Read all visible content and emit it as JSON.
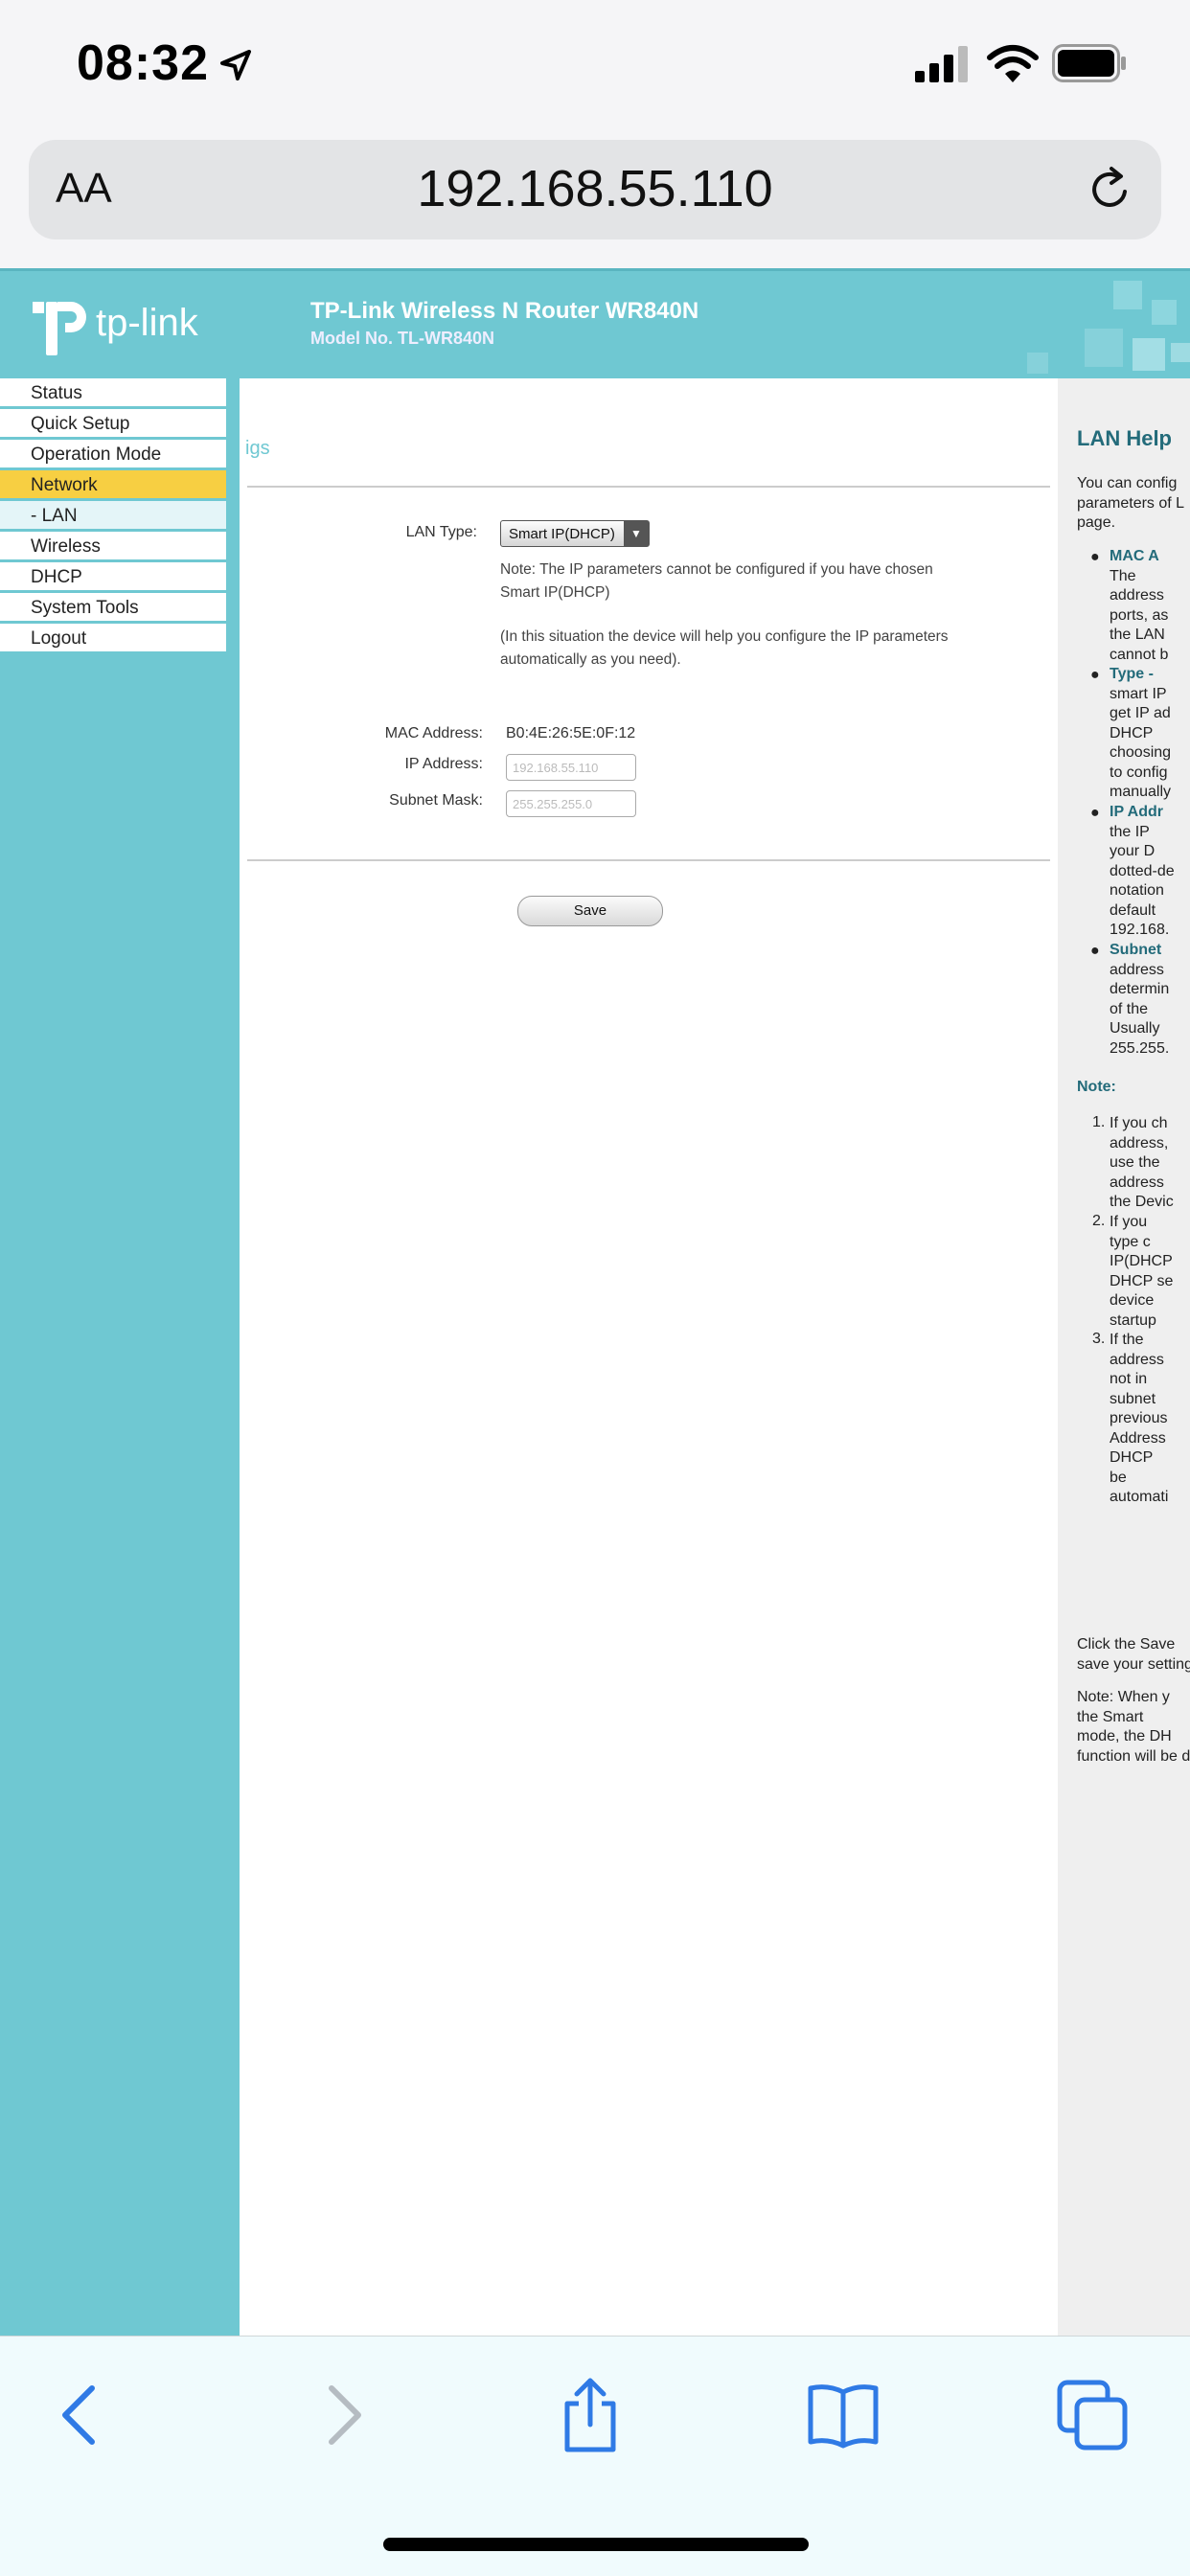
{
  "status_bar": {
    "time": "08:32"
  },
  "address_bar": {
    "text_size_label": "AA",
    "url": "192.168.55.110"
  },
  "banner": {
    "logo_text": "tp-link",
    "title": "TP-Link Wireless N Router WR840N",
    "model": "Model No. TL-WR840N"
  },
  "sidebar": {
    "items": [
      {
        "label": "Status"
      },
      {
        "label": "Quick Setup"
      },
      {
        "label": "Operation Mode"
      },
      {
        "label": "Network"
      },
      {
        "label": "- LAN"
      },
      {
        "label": "Wireless"
      },
      {
        "label": "DHCP"
      },
      {
        "label": "System Tools"
      },
      {
        "label": "Logout"
      }
    ],
    "active": "Network"
  },
  "content": {
    "heading_fragment": "igs",
    "lan_type_label": "LAN Type:",
    "lan_type_value": "Smart IP(DHCP)",
    "note_1_line1": "Note: The IP parameters cannot be configured if you have chosen",
    "note_1_line2": "Smart IP(DHCP)",
    "note_2_line1": "(In this situation the device will help you configure the IP parameters",
    "note_2_line2": "automatically as you need).",
    "mac_label": "MAC Address:",
    "mac_value": "B0:4E:26:5E:0F:12",
    "ip_label": "IP Address:",
    "ip_value": "192.168.55.110",
    "mask_label": "Subnet Mask:",
    "mask_value": "255.255.255.0",
    "save_label": "Save"
  },
  "help": {
    "title": "LAN Help",
    "intro": [
      "You can config",
      "parameters of L",
      "page."
    ],
    "bullets": [
      [
        "MAC A",
        "The",
        "address",
        "ports, as",
        "the LAN",
        "cannot b"
      ],
      [
        "Type -",
        "smart IP",
        "get IP ad",
        "DHCP",
        "choosing",
        "to config",
        "manually"
      ],
      [
        "IP Addr",
        "the IP",
        "your D",
        "dotted-de",
        "notation",
        "default",
        "192.168."
      ],
      [
        "Subnet",
        "address",
        "determin",
        "of the",
        "Usually",
        "255.255."
      ]
    ],
    "note_label": "Note:",
    "notes": [
      [
        "If you ch",
        "address,",
        "use the",
        "address",
        "the Devic"
      ],
      [
        "If you",
        "type c",
        "IP(DHCP",
        "DHCP se",
        "device",
        "startup"
      ],
      [
        "If the",
        "address",
        "not in",
        "subnet",
        "previous",
        "Address",
        "DHCP",
        "be",
        "automati"
      ]
    ],
    "save_para": [
      "Click the Save",
      "save your setting"
    ],
    "note2": [
      "Note: When y",
      "the Smart",
      "mode, the DH",
      "function will be d"
    ]
  }
}
